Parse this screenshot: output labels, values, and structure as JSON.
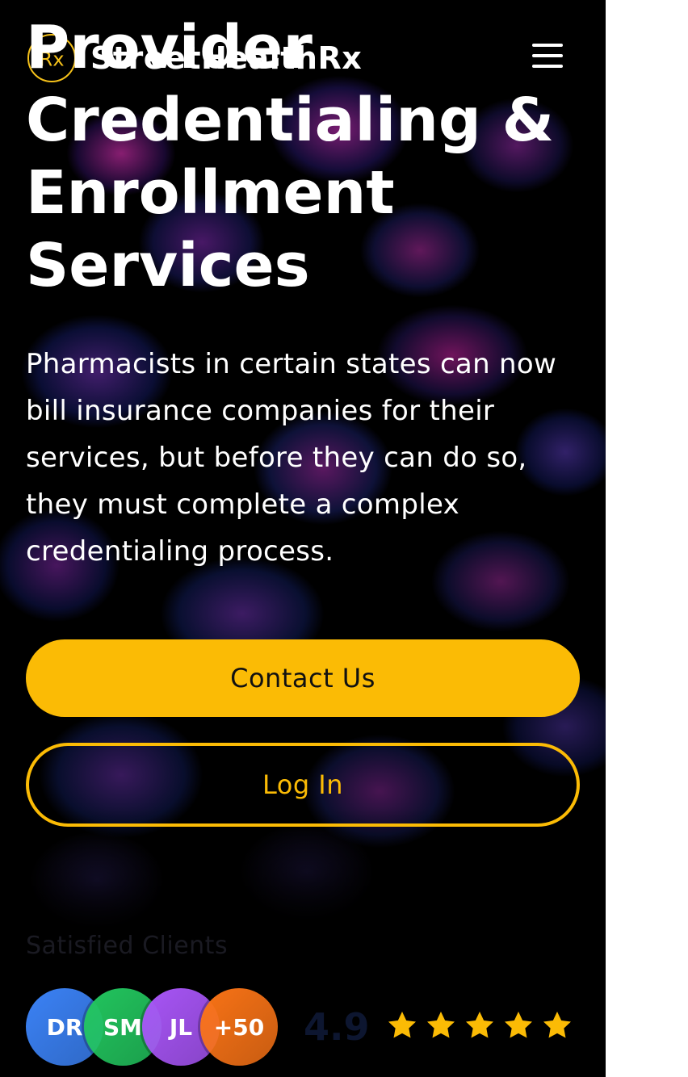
{
  "header": {
    "logo_mark": "Rx",
    "logo_text": "StreetHealthRx",
    "menu_icon": "hamburger-menu-icon"
  },
  "hero": {
    "title": "Provider Credentialing & Enrollment Services",
    "description": "Pharmacists in certain states can now bill insurance companies for their services, but before they can do so, they must complete a complex credentialing process.",
    "contact_label": "Contact Us",
    "login_label": "Log In"
  },
  "social_proof": {
    "label": "Satisfied Clients",
    "avatars": [
      {
        "initials": "DR",
        "color": "#3b82f6"
      },
      {
        "initials": "SM",
        "color": "#22c55e"
      },
      {
        "initials": "JL",
        "color": "#a855f7"
      },
      {
        "initials": "+50",
        "color": "#f97316"
      }
    ],
    "rating": "4.9",
    "stars": 5,
    "star_color": "#fbbb05"
  },
  "colors": {
    "accent": "#fbbb05",
    "background": "#000000",
    "text": "#ffffff"
  }
}
